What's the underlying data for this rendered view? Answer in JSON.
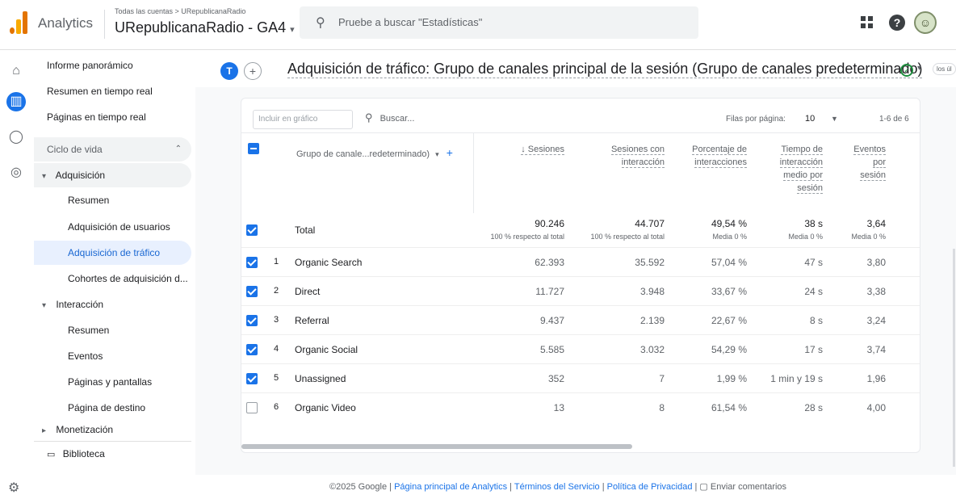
{
  "header": {
    "app_name": "Analytics",
    "breadcrumb": "Todas las cuentas > URepublicanaRadio",
    "property": "URepublicanaRadio - GA4",
    "property_caret": "▾",
    "search_placeholder": "Pruebe a buscar \"Estadísticas\""
  },
  "nav": {
    "items": [
      {
        "label": "Informe panorámico"
      },
      {
        "label": "Resumen en tiempo real"
      },
      {
        "label": "Páginas en tiempo real"
      }
    ],
    "lifecycle": "Ciclo de vida",
    "acquisition": "Adquisición",
    "acquisition_items": [
      "Resumen",
      "Adquisición de usuarios",
      "Adquisición de tráfico",
      "Cohortes de adquisición d..."
    ],
    "interaction": "Interacción",
    "interaction_items": [
      "Resumen",
      "Eventos",
      "Páginas y pantallas",
      "Página de destino"
    ],
    "monetization": "Monetización",
    "library": "Biblioteca"
  },
  "report": {
    "chip_letter": "T",
    "title": "Adquisición de tráfico: Grupo de canales principal de la sesión (Grupo de canales predeterminado)",
    "mini_chip": "los úl"
  },
  "toolbar": {
    "include_placeholder": "Incluir en gráfico",
    "search_label": "Buscar...",
    "rows_label": "Filas por página:",
    "rows_value": "10",
    "page_info": "1-6 de 6"
  },
  "table": {
    "dimension_header": "Grupo de canale...redeterminado)",
    "metrics": [
      {
        "label": "↓ Sesiones"
      },
      {
        "label": "Sesiones con interacción"
      },
      {
        "label": "Porcentaje de interacciones"
      },
      {
        "label": "Tiempo de interacción medio por sesión"
      },
      {
        "label": "Eventos por sesión"
      }
    ],
    "total": {
      "label": "Total",
      "values": [
        "90.246",
        "44.707",
        "49,54 %",
        "38 s",
        "3,64"
      ],
      "subs": [
        "100 % respecto al total",
        "100 % respecto al total",
        "Media 0 %",
        "Media 0 %",
        "Media 0 %"
      ]
    },
    "rows": [
      {
        "idx": "1",
        "name": "Organic Search",
        "checked": true,
        "values": [
          "62.393",
          "35.592",
          "57,04 %",
          "47 s",
          "3,80"
        ]
      },
      {
        "idx": "2",
        "name": "Direct",
        "checked": true,
        "values": [
          "11.727",
          "3.948",
          "33,67 %",
          "24 s",
          "3,38"
        ]
      },
      {
        "idx": "3",
        "name": "Referral",
        "checked": true,
        "values": [
          "9.437",
          "2.139",
          "22,67 %",
          "8 s",
          "3,24"
        ]
      },
      {
        "idx": "4",
        "name": "Organic Social",
        "checked": true,
        "values": [
          "5.585",
          "3.032",
          "54,29 %",
          "17 s",
          "3,74"
        ]
      },
      {
        "idx": "5",
        "name": "Unassigned",
        "checked": true,
        "values": [
          "352",
          "7",
          "1,99 %",
          "1 min y 19 s",
          "1,96"
        ]
      },
      {
        "idx": "6",
        "name": "Organic Video",
        "checked": false,
        "values": [
          "13",
          "8",
          "61,54 %",
          "28 s",
          "4,00"
        ]
      }
    ]
  },
  "footer": {
    "copyright": "©2025 Google |",
    "links": [
      "Página principal de Analytics",
      "Términos del Servicio",
      "Política de Privacidad"
    ],
    "feedback": "Enviar comentarios"
  }
}
